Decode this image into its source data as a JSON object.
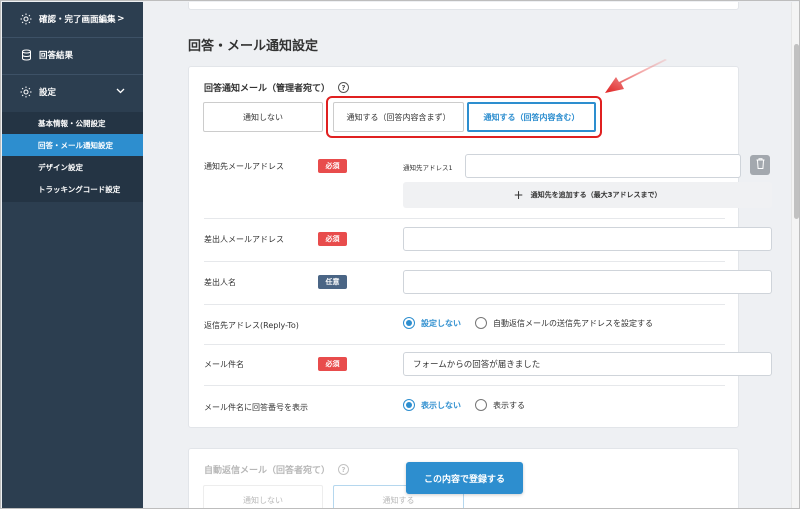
{
  "sidebar": {
    "items": [
      {
        "label": "確認・完了画面編集",
        "icon": "gear-icon",
        "chevron": ">"
      },
      {
        "label": "回答結果",
        "icon": "database-icon"
      },
      {
        "label": "設定",
        "icon": "gear-icon",
        "chevron": "⌄"
      }
    ],
    "subitems": [
      {
        "label": "基本情報・公開設定"
      },
      {
        "label": "回答・メール通知設定",
        "active": true
      },
      {
        "label": "デザイン設定"
      },
      {
        "label": "トラッキングコード設定"
      }
    ]
  },
  "main": {
    "page_title": "回答・メール通知設定",
    "admin_mail": {
      "label": "回答通知メール（管理者宛て）",
      "help": "?",
      "options": [
        "通知しない",
        "通知する（回答内容含まず）",
        "通知する（回答内容含む）"
      ],
      "selected_index": 2
    },
    "rows": {
      "to_address": {
        "label": "通知先メールアドレス",
        "badge": "必須",
        "sub_label": "通知先アドレス1",
        "value": "",
        "add_button": "通知先を追加する（最大3アドレスまで）"
      },
      "from_address": {
        "label": "差出人メールアドレス",
        "badge": "必須",
        "value": ""
      },
      "from_name": {
        "label": "差出人名",
        "badge": "任意",
        "value": ""
      },
      "reply_to": {
        "label": "返信先アドレス(Reply-To)",
        "options": [
          "設定しない",
          "自動返信メールの送信先アドレスを設定する"
        ],
        "selected_index": 0
      },
      "subject": {
        "label": "メール件名",
        "badge": "必須",
        "value": "フォームからの回答が届きました"
      },
      "show_number": {
        "label": "メール件名に回答番号を表示",
        "options": [
          "表示しない",
          "表示する"
        ],
        "selected_index": 0
      }
    },
    "auto_reply": {
      "label": "自動返信メール（回答者宛て）",
      "help": "?",
      "options": [
        "通知しない",
        "通知する"
      ]
    },
    "submit_label": "この内容で登録する"
  },
  "colors": {
    "sidebar_bg": "#2c3e50",
    "accent": "#2d8ecf",
    "required": "#e84c4c",
    "optional": "#4a6585",
    "highlight": "#e02020"
  }
}
